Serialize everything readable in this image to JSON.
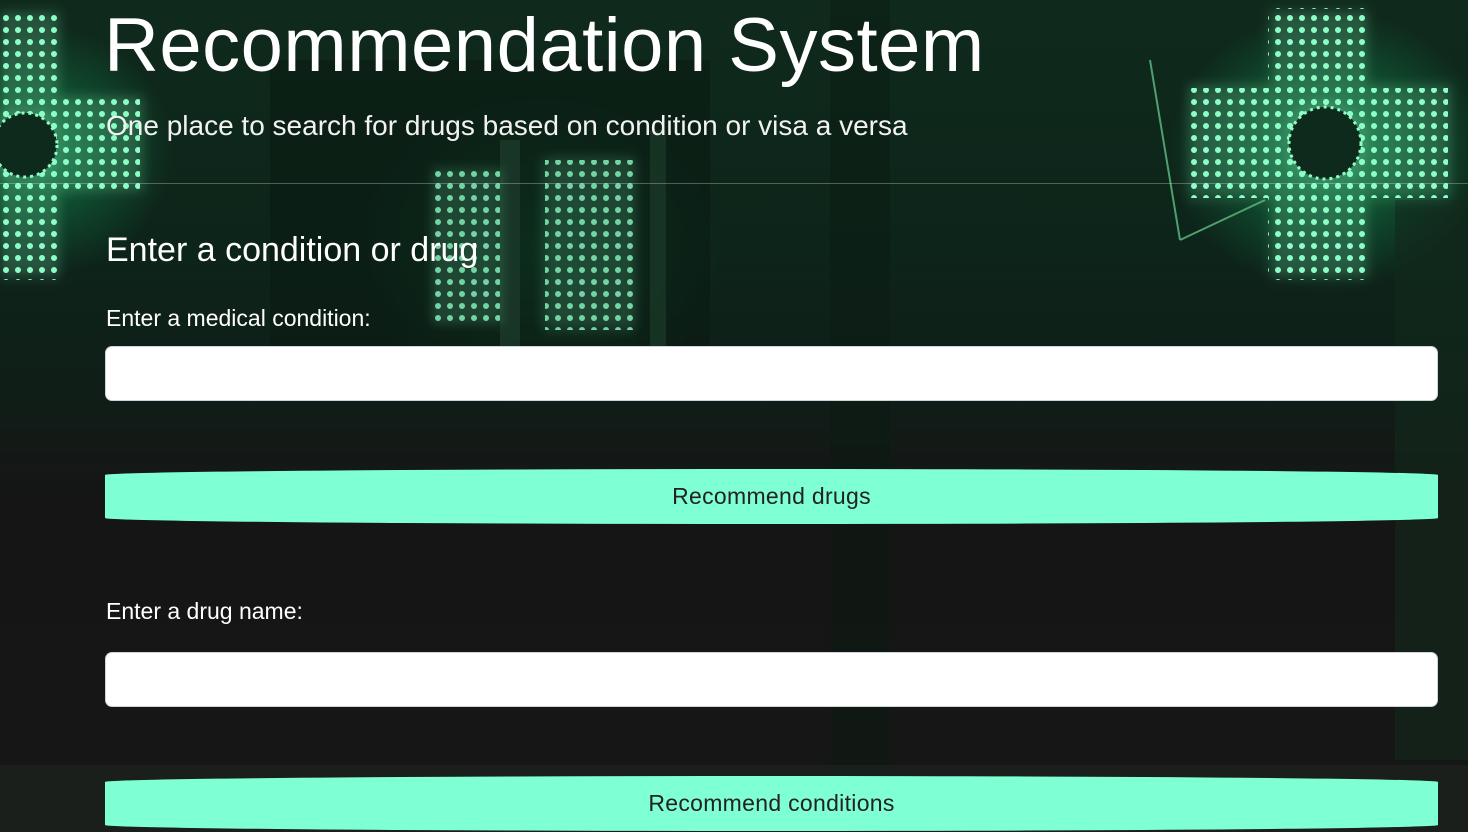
{
  "hero": {
    "title": "Recommendation System",
    "subtitle": "One place to search for drugs based on condition or visa a versa"
  },
  "form": {
    "heading": "Enter a condition or drug",
    "condition": {
      "label": "Enter a medical condition:",
      "value": "",
      "button_label": "Recommend drugs"
    },
    "drug": {
      "label": "Enter a drug name:",
      "value": "",
      "button_label": "Recommend conditions"
    }
  },
  "colors": {
    "button_background": "#7fffd4",
    "page_background": "#161616",
    "accent_glow": "#1ed77a"
  },
  "background": {
    "icons": [
      "pharmacy-cross-sign-icon",
      "pharmacy-cross-sign-icon",
      "pharmacy-cross-sign-icon"
    ]
  }
}
